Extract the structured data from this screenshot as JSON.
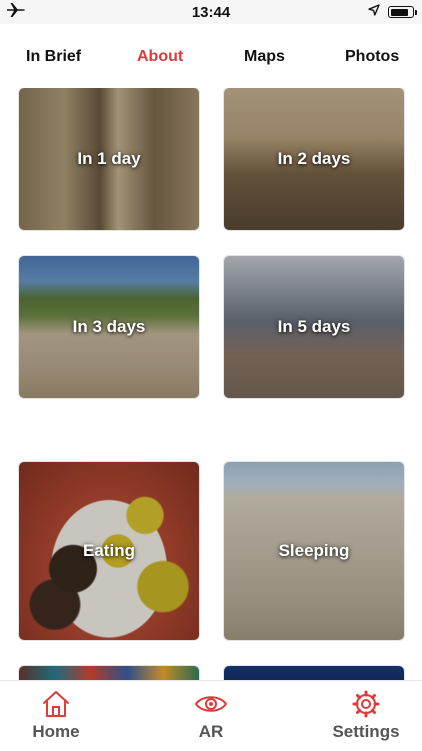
{
  "status_bar": {
    "time": "13:44",
    "icons": [
      "airplane-icon",
      "location-arrow-icon",
      "battery-icon"
    ],
    "battery_level_percent": 85
  },
  "tabs": [
    {
      "label": "In Brief",
      "active": false
    },
    {
      "label": "About",
      "active": true
    },
    {
      "label": "Maps",
      "active": false
    },
    {
      "label": "Photos",
      "active": false
    }
  ],
  "accent_color": "#e03a3a",
  "cards": [
    {
      "label": "In 1 day"
    },
    {
      "label": "In 2 days"
    },
    {
      "label": "In 3 days"
    },
    {
      "label": "In 5 days"
    },
    {
      "label": "Eating"
    },
    {
      "label": "Sleeping"
    }
  ],
  "bottom_nav": [
    {
      "label": "Home",
      "icon": "home-icon"
    },
    {
      "label": "AR",
      "icon": "eye-icon"
    },
    {
      "label": "Settings",
      "icon": "gear-icon"
    }
  ]
}
